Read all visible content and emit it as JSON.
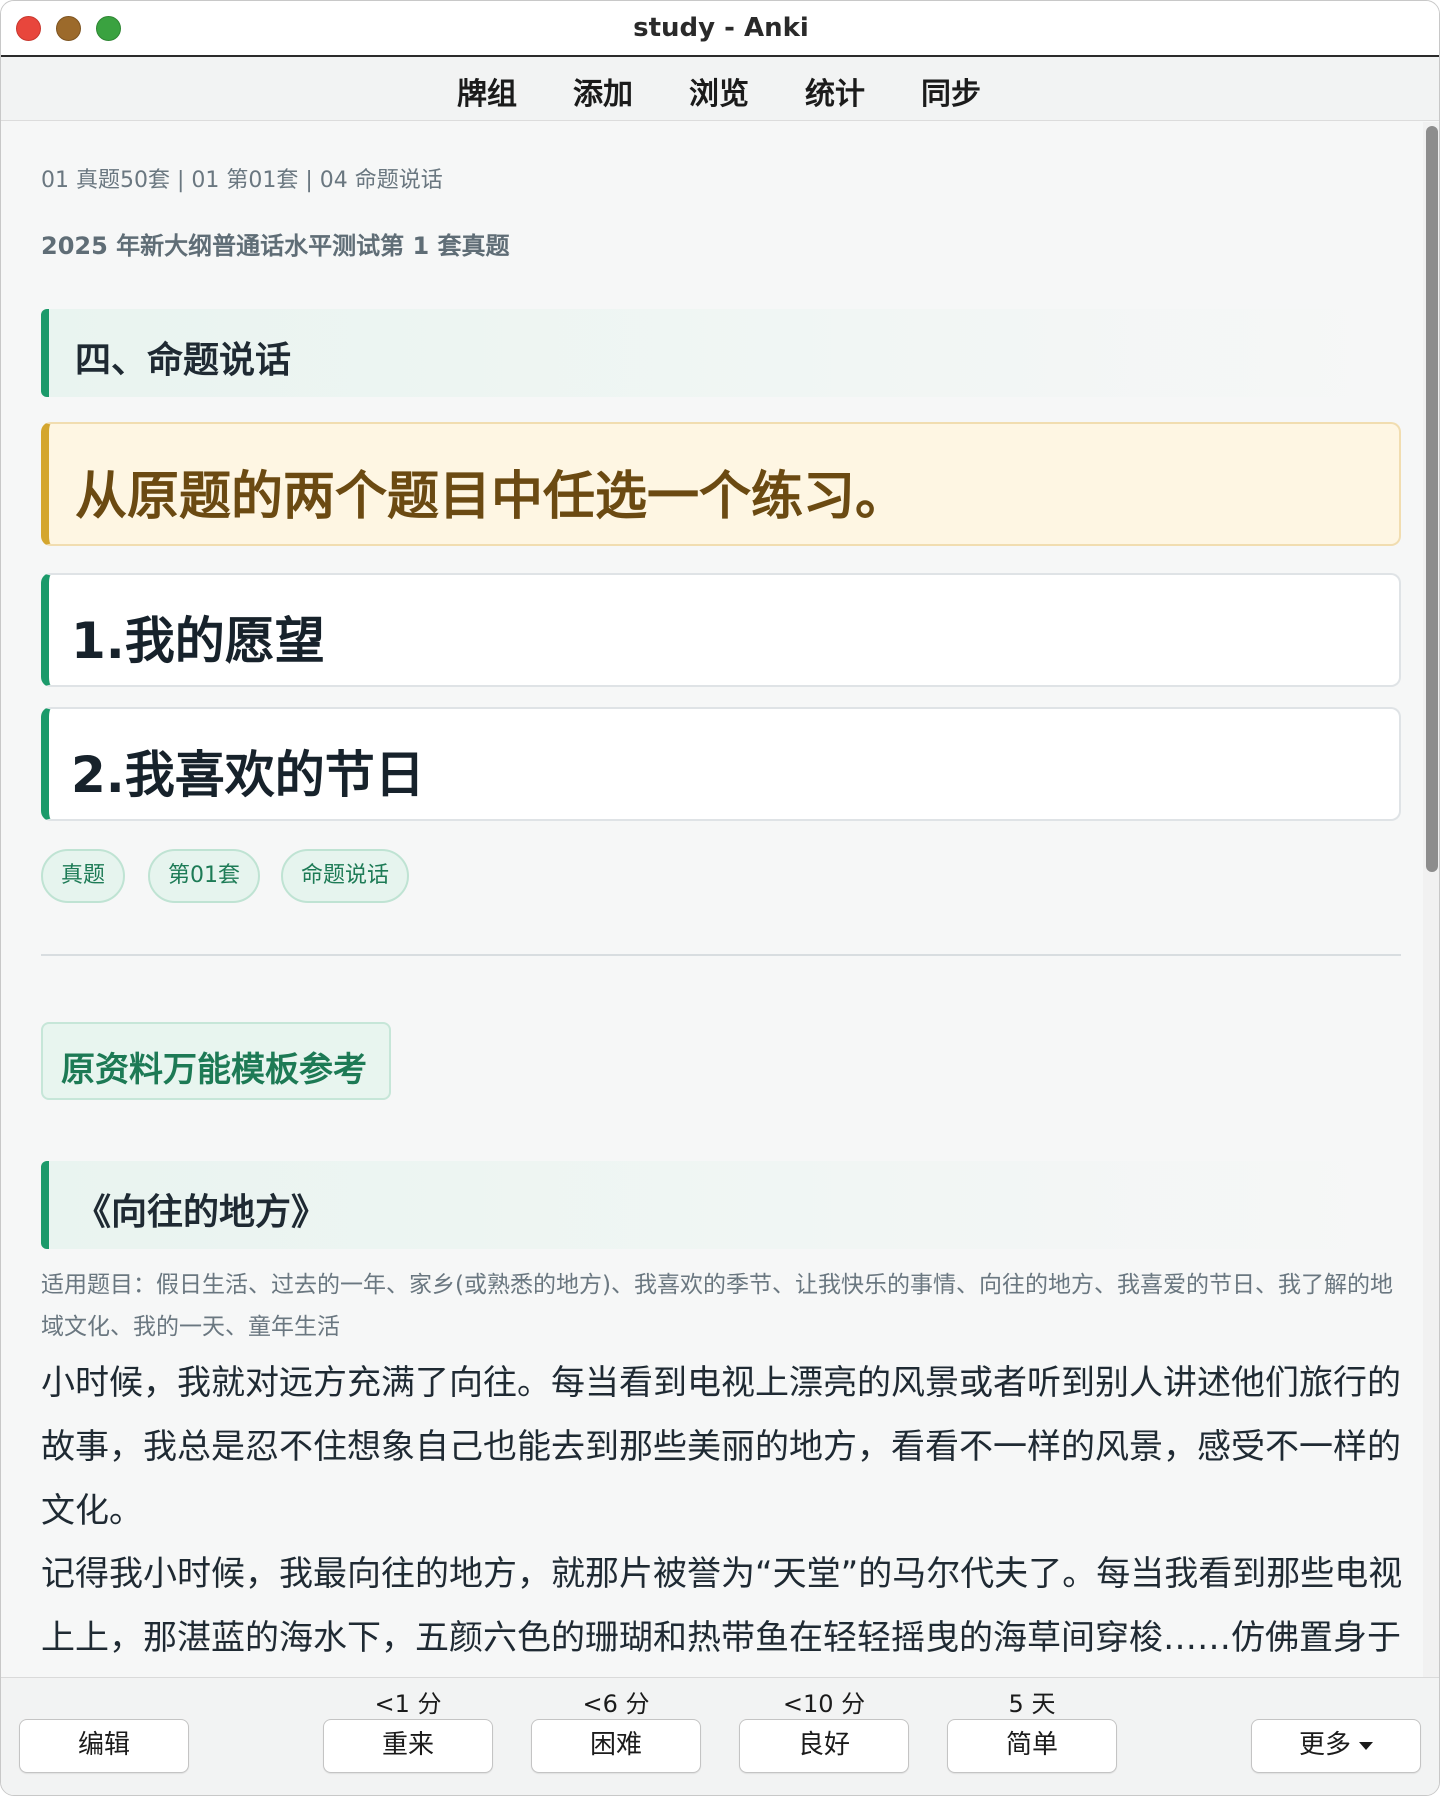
{
  "window": {
    "title": "study - Anki"
  },
  "toolbar": {
    "items": [
      "牌组",
      "添加",
      "浏览",
      "统计",
      "同步"
    ]
  },
  "card": {
    "breadcrumb": "01 真题50套 | 01 第01套 | 04 命题说话",
    "subtitle": "2025 年新大纲普通话水平测试第 1 套真题",
    "section_title": "四、命题说话",
    "instruction": "从原题的两个题目中任选一个练习。",
    "topics": [
      "1.我的愿望",
      "2.我喜欢的节日"
    ],
    "tags": [
      "真题",
      "第01套",
      "命题说话"
    ],
    "reference_button": "原资料万能模板参考",
    "essay_title": "《向往的地方》",
    "applicable": "适用题目：假日生活、过去的一年、家乡(或熟悉的地方)、我喜欢的季节、让我快乐的事情、向往的地方、我喜爱的节日、我了解的地域文化、我的一天、童年生活",
    "paragraphs": [
      "小时候，我就对远方充满了向往。每当看到电视上漂亮的风景或者听到别人讲述他们旅行的故事，我总是忍不住想象自己也能去到那些美丽的地方，看看不一样的风景，感受不一样的文化。",
      "记得我小时候，我最向往的地方，就那片被誉为“天堂”的马尔代夫了。每当我看到那些电视上上，那湛蓝的海水下，五颜六色的珊瑚和热带鱼在轻轻摇曳的海草间穿梭……仿佛置身于"
    ]
  },
  "answer_bar": {
    "edit": "编辑",
    "more": "更多",
    "buttons": [
      {
        "due": "<1 分",
        "label": "重来"
      },
      {
        "due": "<6 分",
        "label": "困难"
      },
      {
        "due": "<10 分",
        "label": "良好"
      },
      {
        "due": "5 天",
        "label": "简单"
      }
    ]
  },
  "colors": {
    "accent_green": "#1b9a6a",
    "instruction_border": "#d4a62e",
    "instruction_bg": "#fef6e3"
  }
}
